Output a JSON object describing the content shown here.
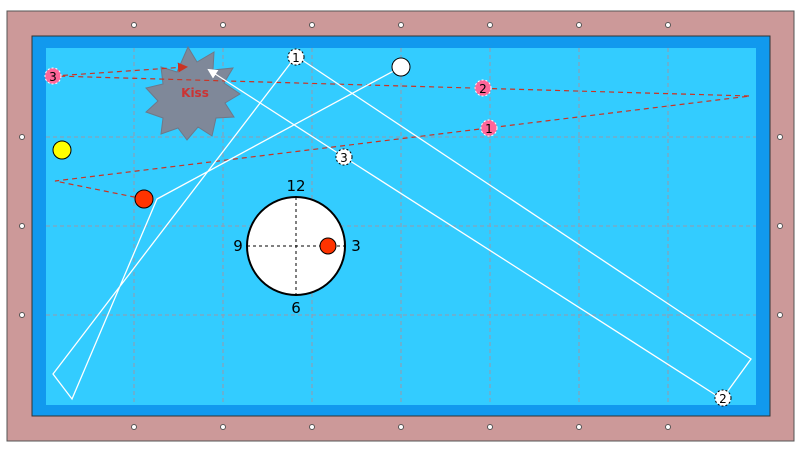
{
  "colors": {
    "rail": "#cc9999",
    "cushion": "#1199ee",
    "cloth": "#33ccff",
    "grid": "#9999aa",
    "cue_ball": "#ffffff",
    "object_ball": "#ff3300",
    "yellow_ball": "#ffff00",
    "pink_marker": "#ff6699",
    "white_path": "#ffffff",
    "red_path": "#cc3322",
    "kiss_fill": "#7f8899",
    "kiss_text": "#cc3333"
  },
  "kiss": {
    "label": "Kiss"
  },
  "clock": {
    "labels": {
      "top": "12",
      "right": "3",
      "bottom": "6",
      "left": "9"
    }
  },
  "cue_path_markers": [
    "1",
    "2",
    "3"
  ],
  "object_path_markers": [
    "1",
    "2",
    "3"
  ]
}
